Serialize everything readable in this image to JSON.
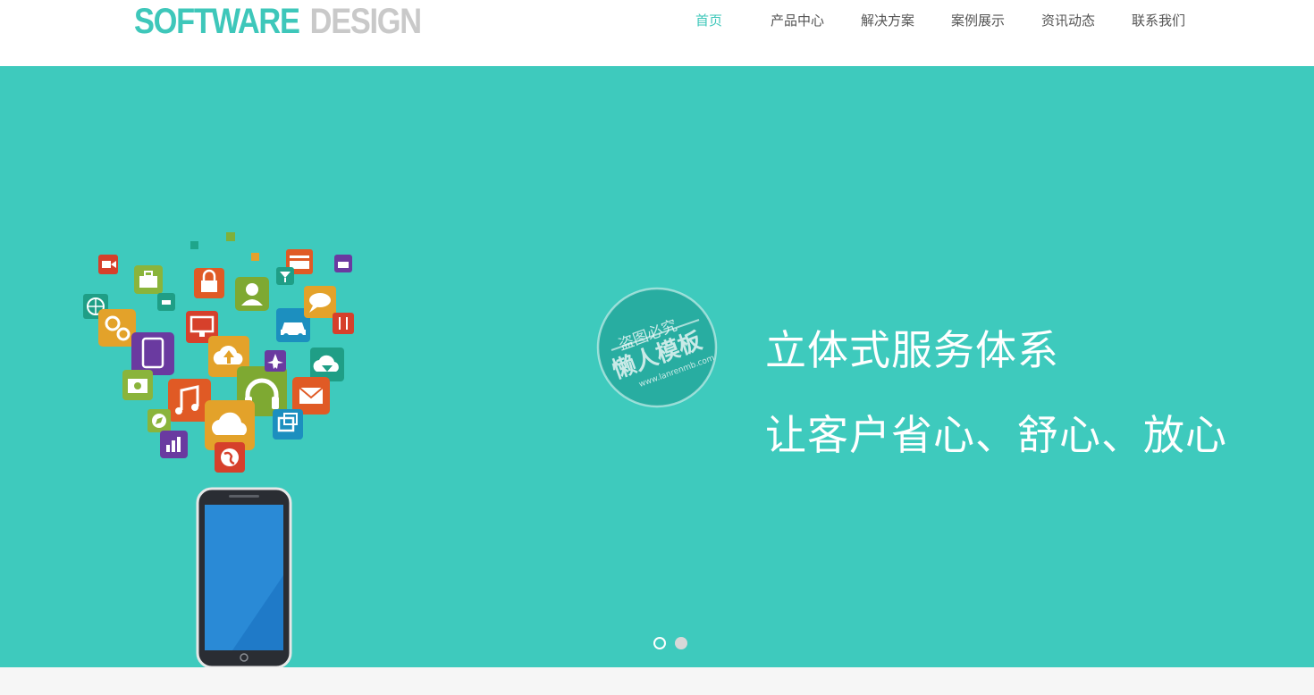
{
  "logo": {
    "word1": "SOFTWARE",
    "word2": "DESIGN"
  },
  "nav": {
    "items": [
      {
        "label": "首页",
        "active": true
      },
      {
        "label": "产品中心"
      },
      {
        "label": "解决方案"
      },
      {
        "label": "案例展示"
      },
      {
        "label": "资讯动态"
      },
      {
        "label": "联系我们"
      }
    ]
  },
  "banner": {
    "line1": "立体式服务体系",
    "line2": "让客户省心、舒心、放心",
    "watermark": {
      "top": "盗图必究",
      "main": "懒人模板",
      "url": "www.lanrenmb.com"
    },
    "slides_total": 2,
    "current_slide": 1
  },
  "colors": {
    "accent": "#3ec7ba",
    "banner_bg": "#3ecabd",
    "logo_gray": "#c9c9c9",
    "nav_text": "#555555"
  },
  "icons": [
    "video-camera-icon",
    "toolbox-icon",
    "lock-icon",
    "user-icon",
    "credit-card-icon",
    "basket-icon",
    "basketball-icon",
    "gears-icon",
    "tablet-icon",
    "monitor-icon",
    "cloud-upload-icon",
    "car-icon",
    "chat-bubble-icon",
    "cutlery-icon",
    "camera-icon",
    "music-icon",
    "headphones-icon",
    "airplane-icon",
    "cloud-download-icon",
    "mail-icon",
    "compass-icon",
    "bar-chart-icon",
    "cloud-icon",
    "windows-icon",
    "globe-icon",
    "smartphone-icon"
  ]
}
